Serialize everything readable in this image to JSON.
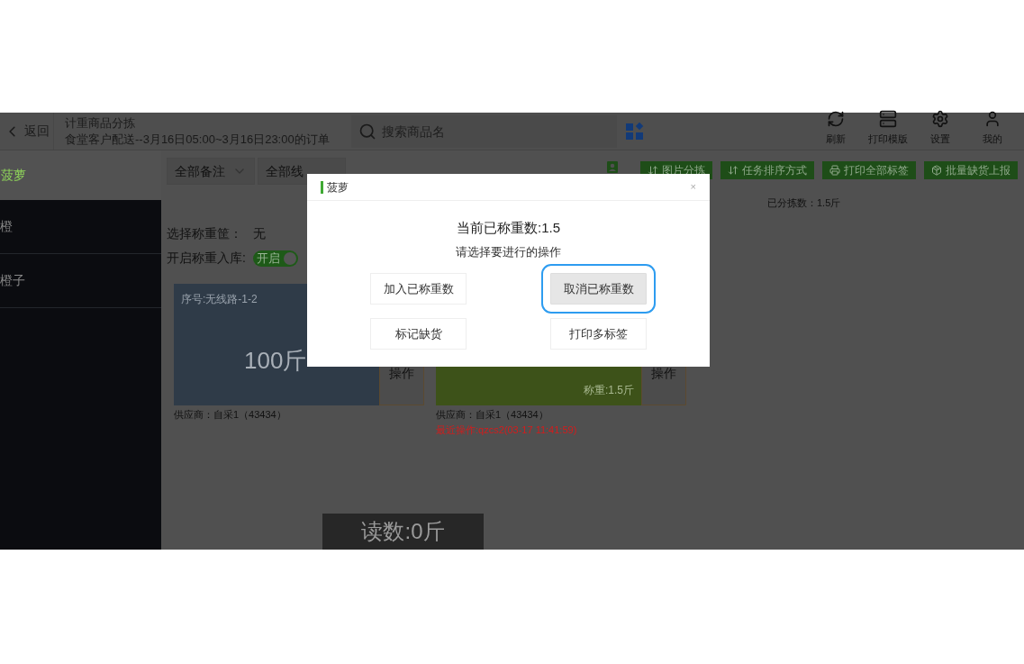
{
  "header": {
    "back_label": "返回",
    "title": "计重商品分拣",
    "subtitle": "食堂客户配送--3月16日05:00~3月16日23:00的订单",
    "search": {
      "placeholder": "搜索商品名"
    },
    "tools": [
      {
        "kind": "refresh",
        "label": "刷新"
      },
      {
        "kind": "template",
        "label": "打印模版"
      },
      {
        "kind": "settings",
        "label": "设置"
      },
      {
        "kind": "user",
        "label": "我的"
      }
    ]
  },
  "product_title": "菠萝",
  "sidebar": {
    "items": [
      {
        "label": "橙"
      },
      {
        "label": "橙子"
      }
    ]
  },
  "filters": [
    "全部备注",
    "全部线"
  ],
  "actions": [
    {
      "kind": "sort",
      "label": "图片分拣"
    },
    {
      "kind": "sort",
      "label": "任务排序方式"
    },
    {
      "kind": "print",
      "label": "打印全部标签"
    },
    {
      "kind": "report",
      "label": "批量缺货上报"
    }
  ],
  "sorted_count": "已分拣数：1.5斤",
  "basket": {
    "label": "选择称重筐：",
    "value": "无"
  },
  "inbound": {
    "label": "开启称重入库:",
    "on": true,
    "text": "开启"
  },
  "cards": [
    {
      "color": "#2f3b48",
      "serial": "序号:无线路-1-2",
      "amount": "100斤",
      "op": "操作",
      "supplier": "供应商：自采1（43434）"
    },
    {
      "color": "#3d5219",
      "weight": "称重:1.5斤",
      "op": "操作",
      "supplier": "供应商：自采1（43434）",
      "last_op": "最近操作:qzcs2(03-17 11:41:59)"
    }
  ],
  "reading": "读数:0斤",
  "dialog": {
    "title": "菠萝",
    "close": "×",
    "heading": "当前已称重数:1.5",
    "prompt": "请选择要进行的操作",
    "buttons": [
      {
        "label": "加入已称重数",
        "selected": false
      },
      {
        "label": "取消已称重数",
        "selected": true
      },
      {
        "label": "标记缺货",
        "selected": false
      },
      {
        "label": "打印多标签",
        "selected": false
      }
    ]
  }
}
